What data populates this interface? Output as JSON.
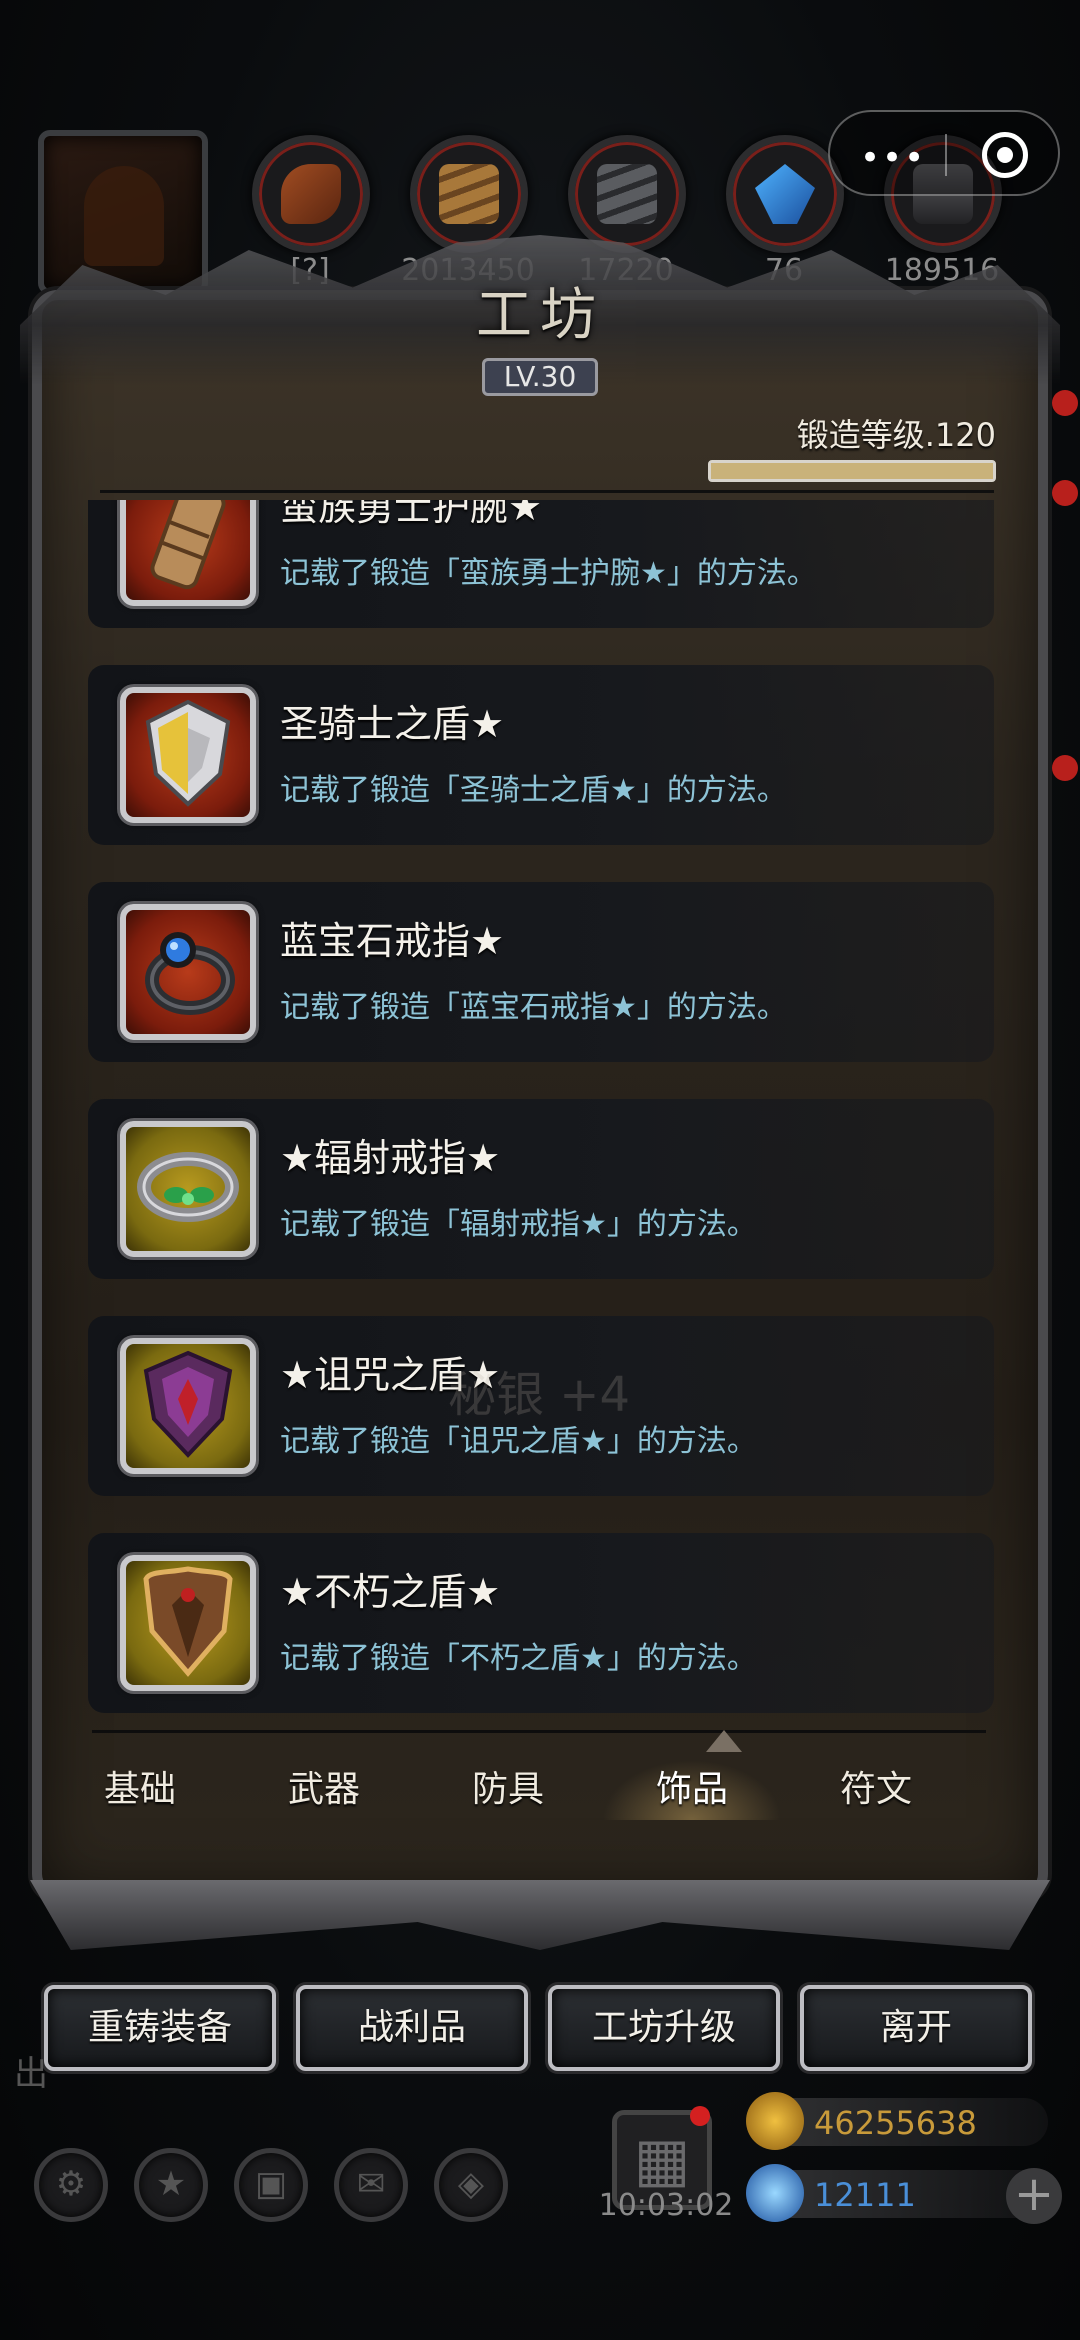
{
  "resources": {
    "values": [
      "[?]",
      "2013450",
      "17220",
      "76",
      "189516"
    ]
  },
  "panel": {
    "title": "工坊",
    "level": "LV.30",
    "forge_level": "锻造等级.120",
    "forge_progress": 1.0
  },
  "recipes": [
    {
      "name": "蛮族勇士护腕★",
      "desc": "记载了锻造「蛮族勇士护腕★」的方法。",
      "icon": "bracer-icon",
      "frame": "red"
    },
    {
      "name": "圣骑士之盾★",
      "desc": "记载了锻造「圣骑士之盾★」的方法。",
      "icon": "paladin-shield-icon",
      "frame": "red"
    },
    {
      "name": "蓝宝石戒指★",
      "desc": "记载了锻造「蓝宝石戒指★」的方法。",
      "icon": "sapphire-ring-icon",
      "frame": "red"
    },
    {
      "name": "★辐射戒指★",
      "desc": "记载了锻造「辐射戒指★」的方法。",
      "icon": "radiant-ring-icon",
      "frame": "yellow"
    },
    {
      "name": "★诅咒之盾★",
      "desc": "记载了锻造「诅咒之盾★」的方法。",
      "icon": "cursed-shield-icon",
      "frame": "yellow"
    },
    {
      "name": "★不朽之盾★",
      "desc": "记载了锻造「不朽之盾★」的方法。",
      "icon": "immortal-shield-icon",
      "frame": "yellow"
    }
  ],
  "overlay_text": "秘银 +4",
  "tabs": [
    {
      "label": "基础",
      "active": false
    },
    {
      "label": "武器",
      "active": false
    },
    {
      "label": "防具",
      "active": false
    },
    {
      "label": "饰品",
      "active": true
    },
    {
      "label": "符文",
      "active": false
    }
  ],
  "actions": [
    "重铸装备",
    "战利品",
    "工坊升级",
    "离开"
  ],
  "hud": {
    "side_label": "出",
    "timer": "10:03:02",
    "gold": "46255638",
    "gems": "12111",
    "plus": "+"
  },
  "colors": {
    "desc_text": "#8dc3d6",
    "gold_text": "#c89a3a",
    "gem_text": "#4a8fd8"
  }
}
